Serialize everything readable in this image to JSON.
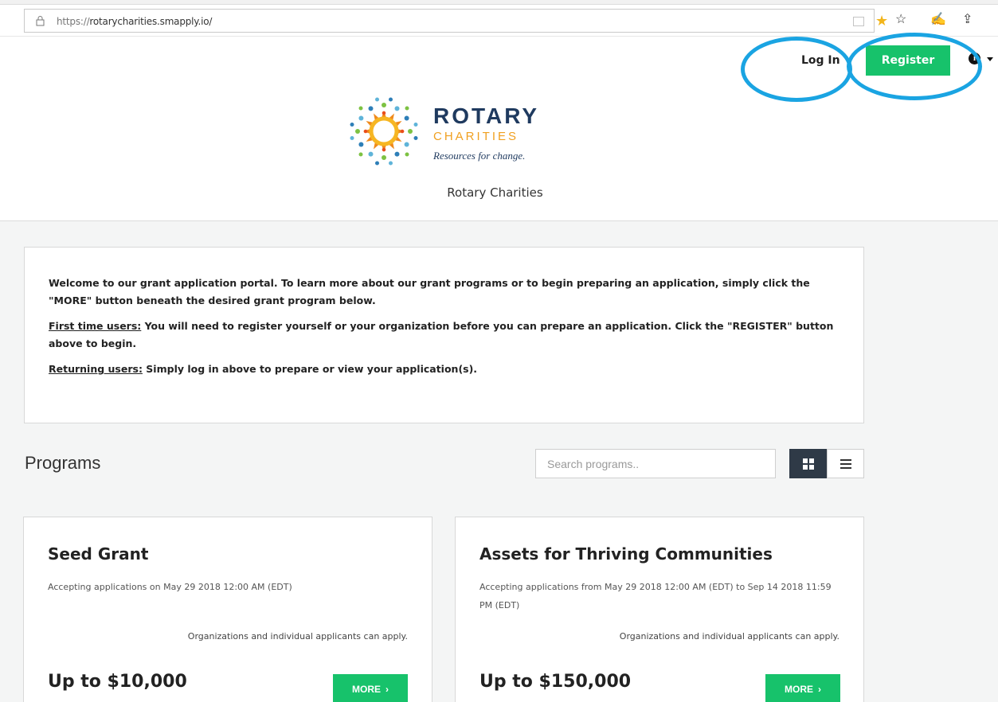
{
  "browser": {
    "url_scheme": "https://",
    "url_host": "rotarycharities.smapply.io/"
  },
  "header": {
    "login_label": "Log In",
    "register_label": "Register",
    "logo": {
      "line1": "ROTARY",
      "line2": "CHARITIES",
      "tagline": "Resources for change."
    },
    "org_name": "Rotary Charities"
  },
  "welcome": {
    "intro": "Welcome to our grant application portal. To learn more about our grant programs or to begin preparing an application, simply click the \"MORE\" button beneath the desired grant program below.",
    "first_time_label": "First time users:",
    "first_time_text": " You will need to register yourself or your organization before you can prepare an application. Click the \"REGISTER\" button above to begin.",
    "returning_label": "Returning users:",
    "returning_text": " Simply log in above to prepare or view your application(s)."
  },
  "programs": {
    "title": "Programs",
    "search_placeholder": "Search programs..",
    "cards": [
      {
        "title": "Seed Grant",
        "dates": "Accepting applications on May 29 2018 12:00 AM (EDT)",
        "eligibility": "Organizations and individual applicants can apply.",
        "amount": "Up to $10,000",
        "button": "MORE"
      },
      {
        "title": "Assets for Thriving Communities",
        "dates": "Accepting applications from May 29 2018 12:00 AM (EDT) to Sep 14 2018 11:59 PM (EDT)",
        "eligibility": "Organizations and individual applicants can apply.",
        "amount": "Up to $150,000",
        "button": "MORE"
      }
    ]
  },
  "colors": {
    "accent_green": "#17c26b",
    "annotation_ring": "#1aa4e2",
    "logo_navy": "#1f3a5f",
    "logo_orange": "#f0a020"
  }
}
